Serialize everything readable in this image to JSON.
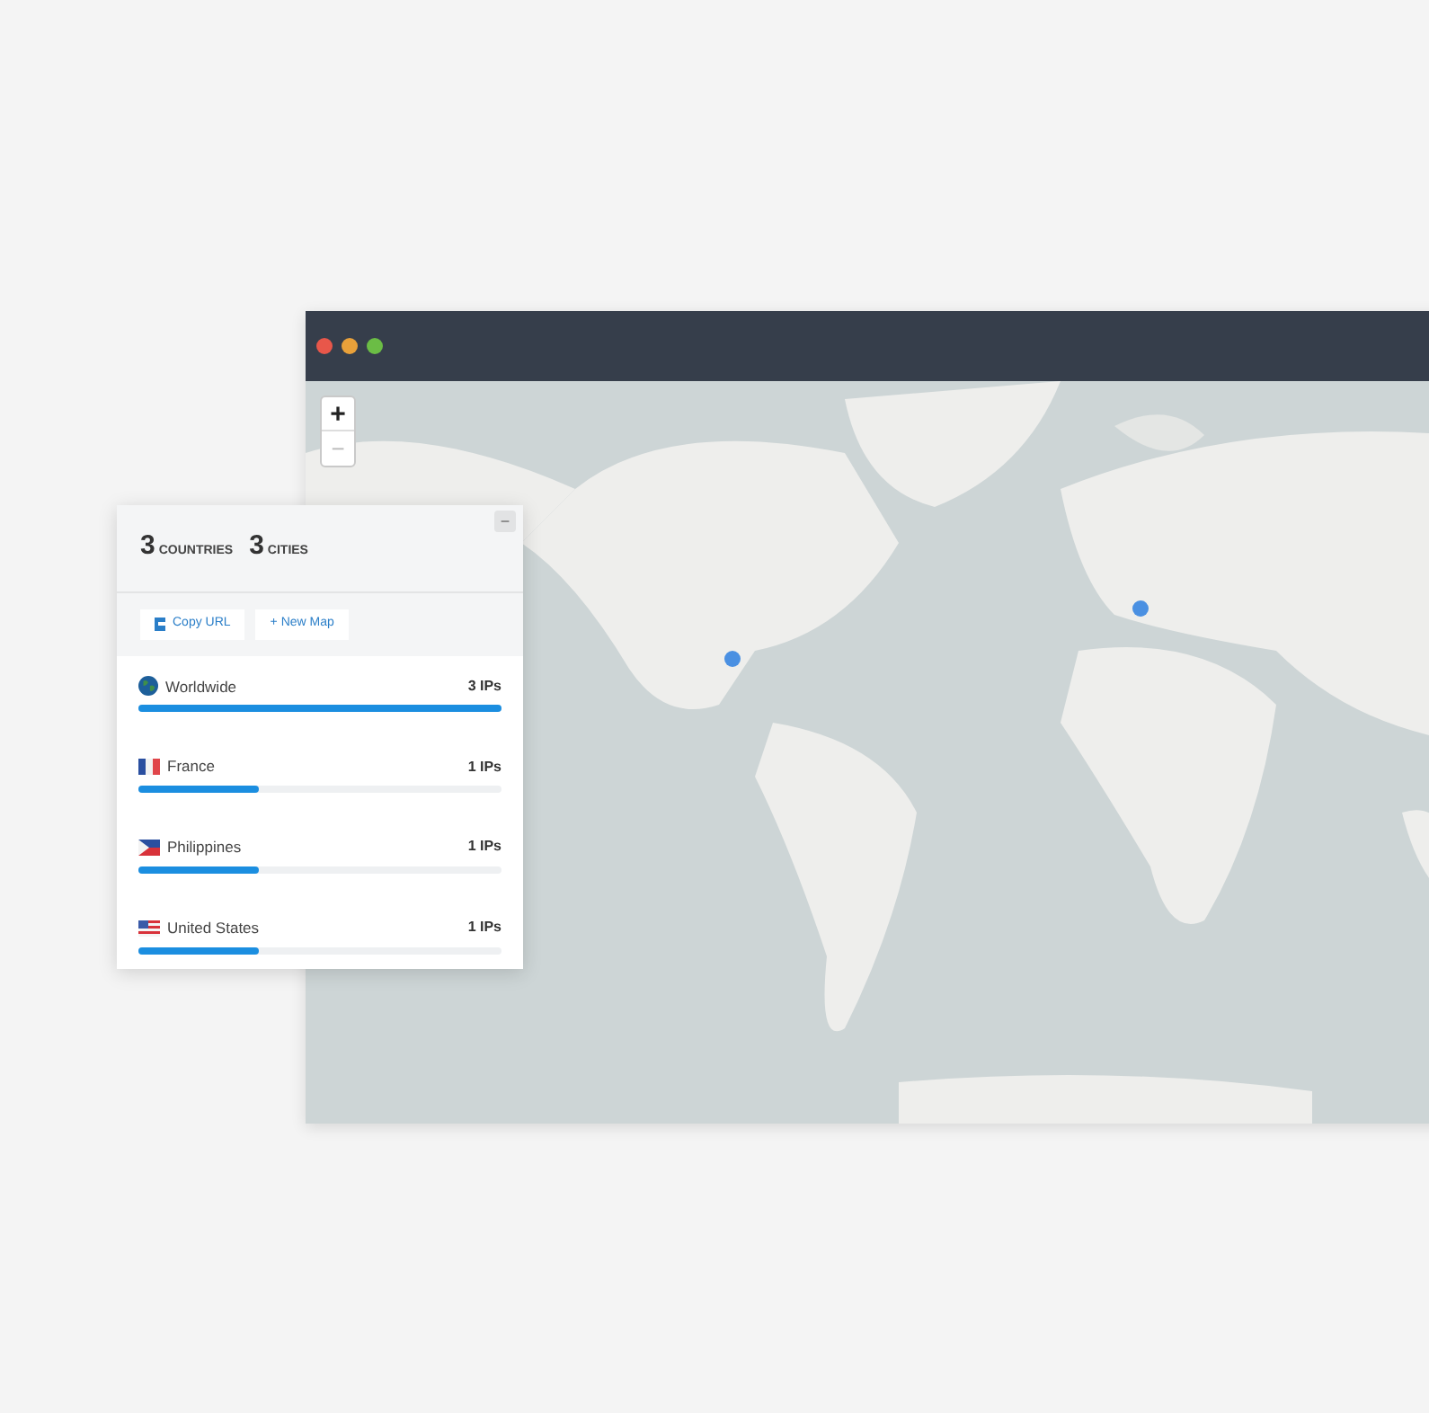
{
  "map": {
    "zoom_in": "+",
    "zoom_out": "−"
  },
  "panel": {
    "collapse": "−",
    "stats": [
      {
        "count": "3",
        "label": "COUNTRIES"
      },
      {
        "count": "3",
        "label": "CITIES"
      }
    ],
    "buttons": [
      {
        "label": "Copy URL",
        "kind": "copy"
      },
      {
        "label": "+ New Map",
        "kind": "plain"
      }
    ],
    "rows": [
      {
        "name": "Worldwide",
        "count": "3 IPs",
        "level": 1
      },
      {
        "name": "France",
        "count": "1 IPs",
        "level": 0.33
      },
      {
        "name": "Philippines",
        "count": "1 IPs",
        "level": 0.33
      },
      {
        "name": "United States",
        "count": "1 IPs",
        "level": 0.33
      }
    ]
  }
}
